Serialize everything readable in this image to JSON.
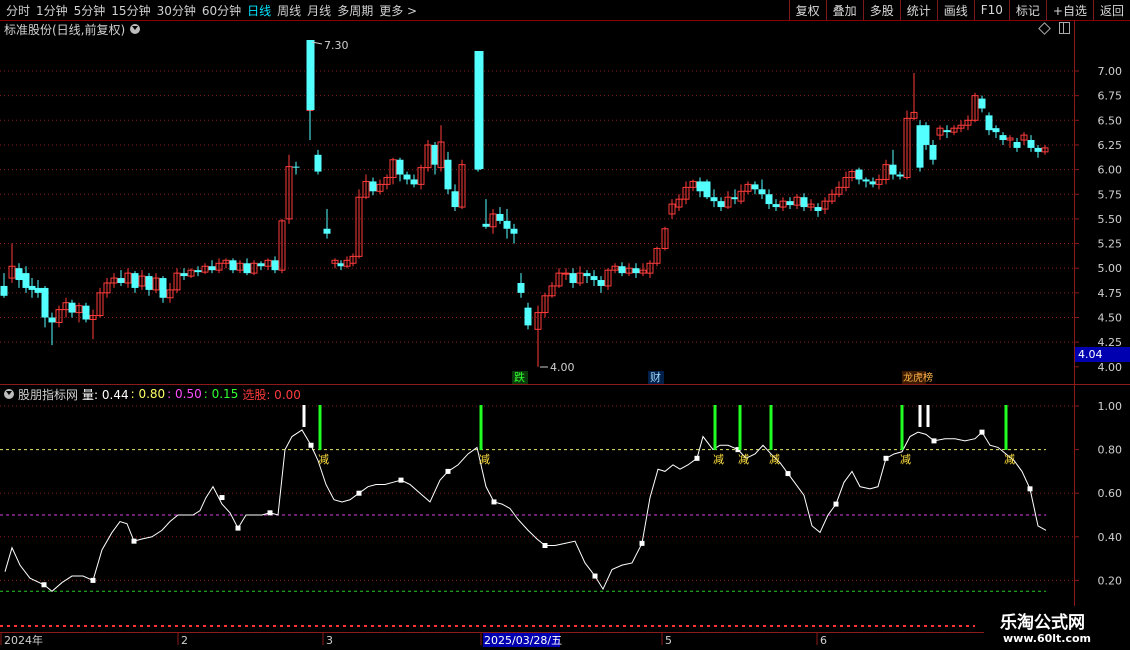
{
  "toolbar": {
    "periods": [
      "分时",
      "1分钟",
      "5分钟",
      "15分钟",
      "30分钟",
      "60分钟",
      "日线",
      "周线",
      "月线",
      "多周期",
      "更多 >"
    ],
    "active_index": 6,
    "right_buttons": [
      "复权",
      "叠加",
      "多股",
      "统计",
      "画线",
      "F10",
      "标记",
      "+自选",
      "返回"
    ]
  },
  "main_title": "标准股份(日线,前复权)",
  "price_axis": [
    "7.00",
    "6.75",
    "6.50",
    "6.25",
    "6.00",
    "5.75",
    "5.50",
    "5.25",
    "5.00",
    "4.75",
    "4.50",
    "4.25",
    "4.00"
  ],
  "current_price": "4.04",
  "max_label": "7.30",
  "min_label": "4.00",
  "markers": [
    "跌",
    "财",
    "龙虎榜"
  ],
  "indicator": {
    "name": "股朋指标网",
    "vol_label": "量: 0.44",
    "v2": ": 0.80",
    "v3": ": 0.50",
    "v4": ": 0.15",
    "pick": "选股: 0.00",
    "axis": [
      "1.00",
      "0.80",
      "0.60",
      "0.40",
      "0.20"
    ],
    "signal_label": "减"
  },
  "date_axis": [
    "2024年",
    "2",
    "3",
    "2025/03/28/五",
    "5",
    "6"
  ],
  "watermark": {
    "line1": "乐淘公式网",
    "line2": "www.60lt.com"
  },
  "colors": {
    "up": "#ff3c3c",
    "down": "#54ffff",
    "signal": "#22ff22",
    "grid": "#8b1a1a"
  },
  "chart_data": [
    {
      "type": "candlestick",
      "title": "标准股份(日线,前复权)",
      "ylim": [
        4.0,
        7.3
      ],
      "high": 7.3,
      "low": 4.0,
      "last": 4.04
    },
    {
      "type": "line",
      "series": [
        {
          "name": "量",
          "last": 0.44
        }
      ],
      "reference_lines": [
        0.8,
        0.5,
        0.15
      ],
      "ylim": [
        0.15,
        1.0
      ],
      "signals": "减"
    }
  ]
}
